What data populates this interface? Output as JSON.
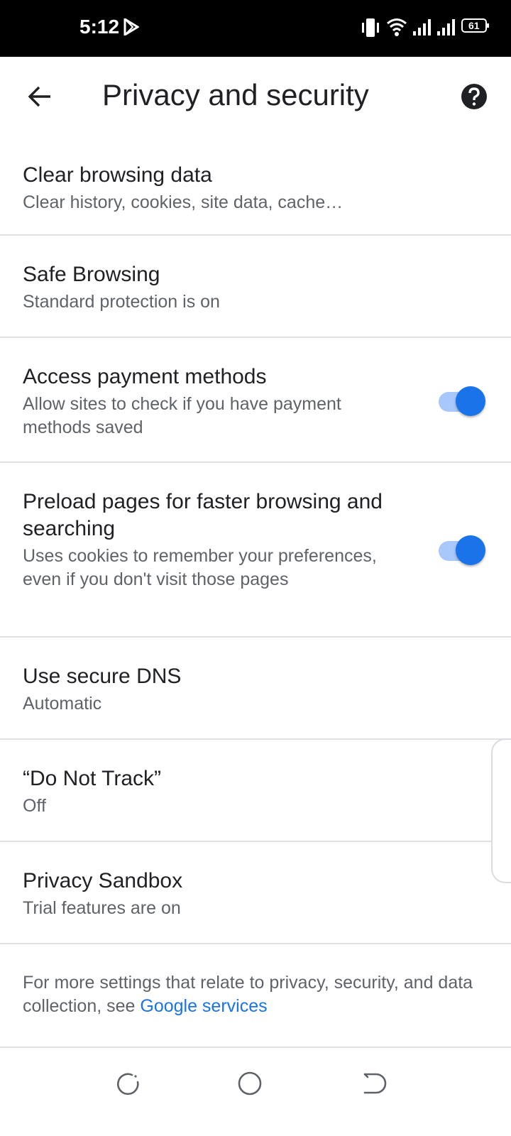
{
  "status_bar": {
    "time": "5:12",
    "battery_level": "61",
    "icons": [
      "play-store-icon",
      "vibrate-icon",
      "wifi-icon",
      "signal-icon",
      "signal-icon",
      "battery-icon"
    ]
  },
  "app_bar": {
    "title": "Privacy and security",
    "back_icon": "arrow-left-icon",
    "help_icon": "help-circle-icon"
  },
  "settings": [
    {
      "title": "Clear browsing data",
      "subtitle": "Clear history, cookies, site data, cache…"
    },
    {
      "title": "Safe Browsing",
      "subtitle": "Standard protection is on"
    },
    {
      "title": "Access payment methods",
      "subtitle": "Allow sites to check if you have payment methods saved",
      "toggle_on": true
    },
    {
      "title": "Preload pages for faster browsing and searching",
      "subtitle": "Uses cookies to remember your preferences, even if you don't visit those pages",
      "toggle_on": true
    },
    {
      "title": "Use secure DNS",
      "subtitle": "Automatic"
    },
    {
      "title": "“Do Not Track”",
      "subtitle": "Off"
    },
    {
      "title": "Privacy Sandbox",
      "subtitle": "Trial features are on"
    }
  ],
  "footer": {
    "text": "For more settings that relate to privacy, security, and data collection, see ",
    "link": "Google services"
  },
  "colors": {
    "accent": "#1a73e8",
    "toggle_track": "#a8c7fa",
    "title_text": "#202124",
    "subtitle_text": "#5f6368",
    "divider": "#e0e0e0"
  },
  "nav_bar": {
    "icons": [
      "recents-icon",
      "home-icon",
      "back-gesture-icon"
    ]
  }
}
